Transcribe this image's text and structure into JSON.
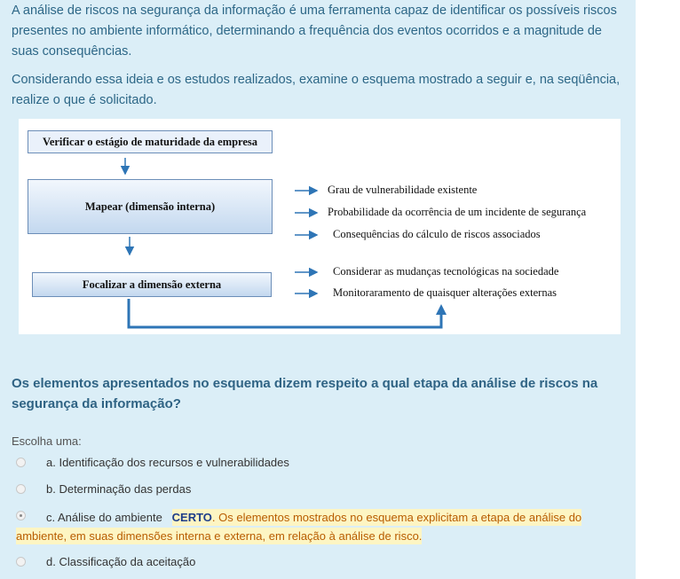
{
  "intro": {
    "p1": "A análise de riscos na segurança da informação é uma ferramenta capaz de identificar os possíveis riscos presentes no ambiente informático, determinando a frequência dos eventos ocorridos e a magnitude de suas consequências.",
    "p2": "Considerando essa ideia e os estudos realizados, examine o esquema mostrado a seguir e, na seqüência, realize o que é solicitado."
  },
  "diagram": {
    "box_verify": "Verificar o estágio de maturidade da empresa",
    "box_map": "Mapear (dimensão interna)",
    "box_focus": "Focalizar a dimensão externa",
    "map_items": [
      "Grau de vulnerabilidade existente",
      "Probabilidade da ocorrência de um incidente de segurança",
      "Consequências do cálculo de riscos associados"
    ],
    "focus_items": [
      "Considerar as mudanças tecnológicas na sociedade",
      "Monitoraramento de quaisquer alterações externas"
    ],
    "arrow_color": "#2e75b6"
  },
  "question": "Os elementos apresentados no esquema dizem respeito a qual etapa da análise de riscos na segurança da informação?",
  "choose_label": "Escolha uma:",
  "options": [
    {
      "label": "a. Identificação dos recursos e vulnerabilidades",
      "selected": false
    },
    {
      "label": "b. Determinação das perdas",
      "selected": false
    },
    {
      "label": "c. Análise do ambiente",
      "selected": true
    },
    {
      "label": "d. Classificação da aceitação",
      "selected": false
    }
  ],
  "feedback": {
    "badge": "CERTO",
    "text": ". Os elementos mostrados no esquema explicitam a etapa de análise do ambiente, em suas dimensões interna e externa, em relação à análise de risco."
  },
  "colors": {
    "panel_bg": "#dbeef7",
    "intro_text": "#2d6787",
    "question_text": "#2f6384",
    "feedback_highlight": "#fdf5c3"
  }
}
